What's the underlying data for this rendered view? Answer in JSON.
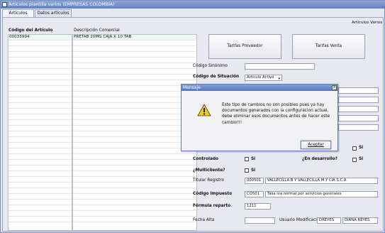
{
  "window": {
    "title": "Artículos plantilla varios (EMPRESAS COLOMBIA)"
  },
  "tabs": [
    {
      "label": "Artículos"
    },
    {
      "label": "Datos artículos"
    }
  ],
  "panel": {
    "varios_label": "Artículos Varios"
  },
  "grid": {
    "headers": {
      "code": "Código del Artículo",
      "description": "Descripción Comercial"
    },
    "rows": [
      {
        "code": "00033994",
        "description": "PRETAB 20MG CAJA X 10 TAB"
      }
    ]
  },
  "buttons": {
    "tarifas_proveedor": "Tarifas Proveedor",
    "tarifas_venta": "Tarifas Venta"
  },
  "form": {
    "codigo_sinonimo_label": "Código Sinónimo",
    "codigo_situacion_label": "Código de Situación",
    "codigo_situacion_value": "Artículo Activo",
    "controlado_label": "Controlado",
    "si_label": "Si",
    "en_desarrollo_label": "¿En desarrollo?",
    "multicliente_label": "¿Multicliente?",
    "titular_label": "Titular Registro",
    "titular_code": "000501",
    "titular_name": "VALLECILLA B Y VALLECILLA M Y CIA S.C.A",
    "impuesto_label": "Código Impuesto",
    "impuesto_code": "CO501",
    "impuesto_desc": "Tasa iva normal por servicios generales",
    "formula_label": "Fórmula reparto",
    "formula_value": "1211",
    "fecha_alta_label": "Fecha Alta",
    "usuario_label": "Usuario Modificación",
    "usuario_code": "DREYES",
    "usuario_name": "DIANA REYES"
  },
  "dialog": {
    "title": "Mensaje",
    "message_lines": [
      "Este tipo de cambios no son posibles pues ya hay",
      "documentos generados con la configuracion actual,",
      "debe eliminar esos documentos antes de hacer este",
      "cambio!!!"
    ],
    "ok_label": "Aceptar"
  },
  "colors": {
    "title_bar": "#5f80c4",
    "panel_bg": "#e7e8f0",
    "warning": "#f5d000"
  }
}
